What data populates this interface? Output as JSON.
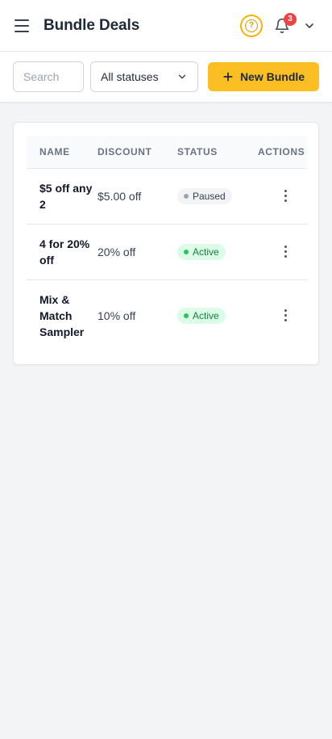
{
  "header": {
    "title": "Bundle Deals",
    "notification_count": "3",
    "icons": [
      "menu-icon",
      "help-icon",
      "bell-icon",
      "chevron-down-icon"
    ]
  },
  "toolbar": {
    "search_placeholder": "Search",
    "status_filter": "All statuses",
    "new_bundle_label": "New Bundle"
  },
  "table": {
    "columns": [
      "NAME",
      "DISCOUNT",
      "STATUS",
      "ACTIONS"
    ],
    "rows": [
      {
        "name": "$5 off any 2",
        "discount": "$5.00 off",
        "status": "Paused"
      },
      {
        "name": "4 for 20% off",
        "discount": "20% off",
        "status": "Active"
      },
      {
        "name": "Mix & Match Sampler",
        "discount": "10% off",
        "status": "Active"
      }
    ]
  },
  "colors": {
    "accent": "#fbbf24",
    "badge": "#ef4444",
    "active_bg": "#dcfce7",
    "active_text": "#15803d",
    "paused_bg": "#f3f4f6"
  }
}
